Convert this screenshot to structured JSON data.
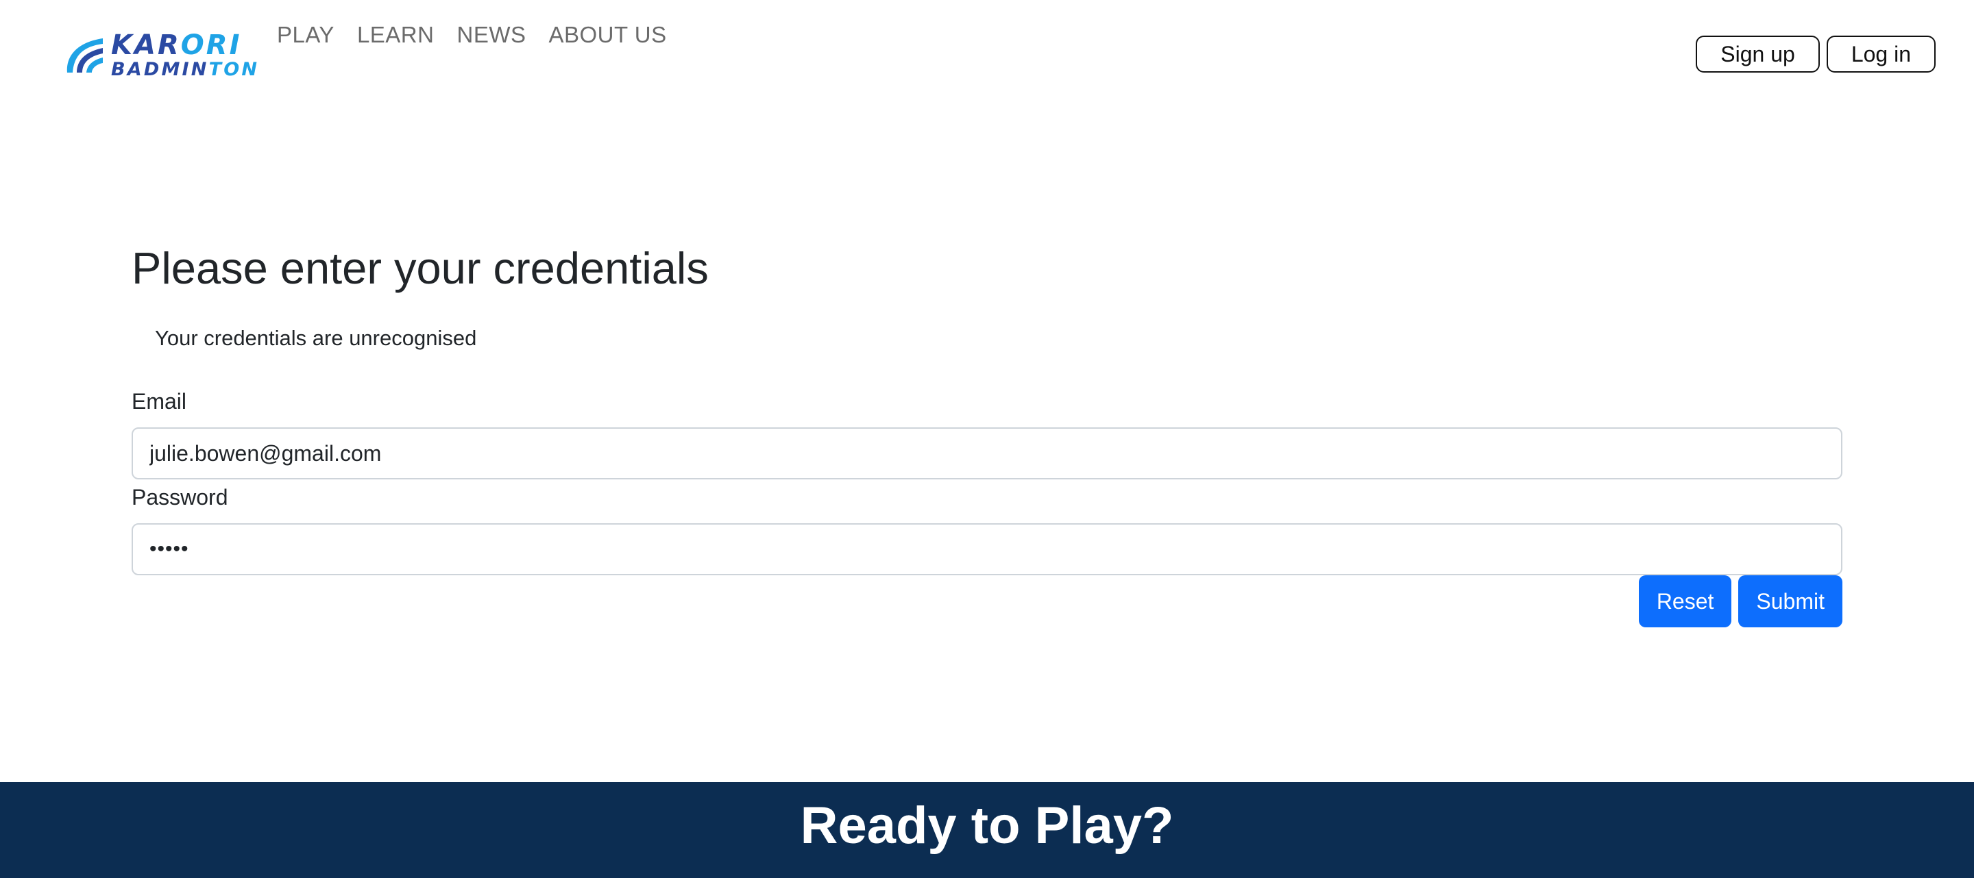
{
  "brand": {
    "line1_a": "KAR",
    "line1_b": "O",
    "line1_c": "RI",
    "line2_a": "BADMIN",
    "line2_b": "TON"
  },
  "nav": {
    "items": [
      "PLAY",
      "LEARN",
      "NEWS",
      "ABOUT US"
    ]
  },
  "auth": {
    "signup_label": "Sign up",
    "login_label": "Log in"
  },
  "form": {
    "title": "Please enter your credentials",
    "error": "Your credentials are unrecognised",
    "email_label": "Email",
    "email_value": "julie.bowen@gmail.com",
    "password_label": "Password",
    "password_value": "•••••",
    "reset_label": "Reset",
    "submit_label": "Submit"
  },
  "cta": {
    "title": "Ready to Play?"
  },
  "colors": {
    "brand_dark": "#2b4aa3",
    "brand_light": "#1fa3e6",
    "primary_button": "#0d6efd",
    "footer_band": "#0c2d52"
  }
}
